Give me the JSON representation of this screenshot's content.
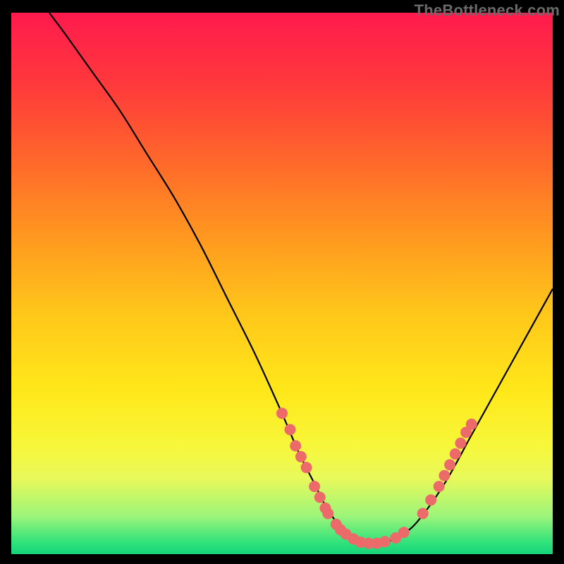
{
  "watermark": "TheBottleneck.com",
  "chart_data": {
    "type": "line",
    "title": "",
    "xlabel": "",
    "ylabel": "",
    "xlim": [
      0,
      100
    ],
    "ylim": [
      0,
      100
    ],
    "grid": false,
    "legend": false,
    "series": [
      {
        "name": "curve",
        "color": "#000000",
        "x": [
          7,
          10,
          15,
          20,
          25,
          30,
          35,
          40,
          45,
          50,
          53,
          56,
          58,
          60,
          62,
          64,
          66,
          68,
          70,
          72,
          75,
          80,
          85,
          90,
          95,
          100
        ],
        "y": [
          100,
          96,
          89,
          82,
          74,
          66,
          57,
          47,
          37,
          26,
          19,
          13,
          9,
          6,
          4,
          2.5,
          2,
          2,
          2.5,
          3.5,
          6,
          13,
          22,
          31,
          40,
          49
        ]
      }
    ],
    "markers": [
      {
        "name": "left-cluster",
        "color": "#ec6a6a",
        "points": [
          {
            "x": 50,
            "y": 26
          },
          {
            "x": 51.5,
            "y": 23
          },
          {
            "x": 52.5,
            "y": 20
          },
          {
            "x": 53.5,
            "y": 18
          },
          {
            "x": 54.5,
            "y": 16
          },
          {
            "x": 56,
            "y": 12.5
          },
          {
            "x": 57,
            "y": 10.5
          },
          {
            "x": 58,
            "y": 8.5
          },
          {
            "x": 58.5,
            "y": 7.5
          }
        ]
      },
      {
        "name": "valley-cluster",
        "color": "#ec6a6a",
        "points": [
          {
            "x": 60,
            "y": 5.5
          },
          {
            "x": 60.8,
            "y": 4.5
          },
          {
            "x": 61.8,
            "y": 3.7
          },
          {
            "x": 63.2,
            "y": 2.8
          },
          {
            "x": 64.5,
            "y": 2.2
          },
          {
            "x": 66,
            "y": 2
          },
          {
            "x": 67.5,
            "y": 2
          },
          {
            "x": 69,
            "y": 2.3
          },
          {
            "x": 71,
            "y": 3
          },
          {
            "x": 72.5,
            "y": 4
          }
        ]
      },
      {
        "name": "right-cluster",
        "color": "#ec6a6a",
        "points": [
          {
            "x": 76,
            "y": 7.5
          },
          {
            "x": 77.5,
            "y": 10
          },
          {
            "x": 79,
            "y": 12.5
          },
          {
            "x": 80,
            "y": 14.5
          },
          {
            "x": 81,
            "y": 16.5
          },
          {
            "x": 82,
            "y": 18.5
          },
          {
            "x": 83,
            "y": 20.5
          },
          {
            "x": 84,
            "y": 22.5
          },
          {
            "x": 85,
            "y": 24
          }
        ]
      }
    ]
  }
}
